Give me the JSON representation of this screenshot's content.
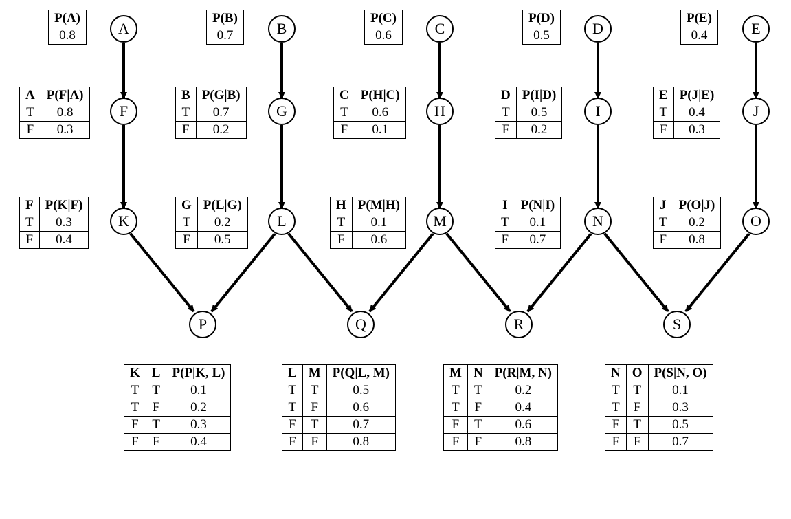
{
  "nodes": {
    "A": {
      "label": "A"
    },
    "B": {
      "label": "B"
    },
    "C": {
      "label": "C"
    },
    "D": {
      "label": "D"
    },
    "E": {
      "label": "E"
    },
    "F": {
      "label": "F"
    },
    "G": {
      "label": "G"
    },
    "H": {
      "label": "H"
    },
    "I": {
      "label": "I"
    },
    "J": {
      "label": "J"
    },
    "K": {
      "label": "K"
    },
    "L": {
      "label": "L"
    },
    "M": {
      "label": "M"
    },
    "N": {
      "label": "N"
    },
    "O": {
      "label": "O"
    },
    "P": {
      "label": "P"
    },
    "Q": {
      "label": "Q"
    },
    "R": {
      "label": "R"
    },
    "S": {
      "label": "S"
    }
  },
  "priors": {
    "A": {
      "header": "P(A)",
      "value": "0.8"
    },
    "B": {
      "header": "P(B)",
      "value": "0.7"
    },
    "C": {
      "header": "P(C)",
      "value": "0.6"
    },
    "D": {
      "header": "P(D)",
      "value": "0.5"
    },
    "E": {
      "header": "P(E)",
      "value": "0.4"
    }
  },
  "cond1": {
    "F": {
      "parent": "A",
      "header": "P(F|A)",
      "T": "0.8",
      "F": "0.3"
    },
    "G": {
      "parent": "B",
      "header": "P(G|B)",
      "T": "0.7",
      "F": "0.2"
    },
    "H": {
      "parent": "C",
      "header": "P(H|C)",
      "T": "0.6",
      "F": "0.1"
    },
    "I": {
      "parent": "D",
      "header": "P(I|D)",
      "T": "0.5",
      "F": "0.2"
    },
    "J": {
      "parent": "E",
      "header": "P(J|E)",
      "T": "0.4",
      "F": "0.3"
    },
    "K": {
      "parent": "F",
      "header": "P(K|F)",
      "T": "0.3",
      "F": "0.4"
    },
    "L": {
      "parent": "G",
      "header": "P(L|G)",
      "T": "0.2",
      "F": "0.5"
    },
    "M": {
      "parent": "H",
      "header": "P(M|H)",
      "T": "0.1",
      "F": "0.6"
    },
    "N": {
      "parent": "I",
      "header": "P(N|I)",
      "T": "0.1",
      "F": "0.7"
    },
    "O": {
      "parent": "J",
      "header": "P(O|J)",
      "T": "0.2",
      "F": "0.8"
    }
  },
  "cond2": {
    "P": {
      "p1": "K",
      "p2": "L",
      "header": "P(P|K, L)",
      "TT": "0.1",
      "TF": "0.2",
      "FT": "0.3",
      "FF": "0.4"
    },
    "Q": {
      "p1": "L",
      "p2": "M",
      "header": "P(Q|L, M)",
      "TT": "0.5",
      "TF": "0.6",
      "FT": "0.7",
      "FF": "0.8"
    },
    "R": {
      "p1": "M",
      "p2": "N",
      "header": "P(R|M, N)",
      "TT": "0.2",
      "TF": "0.4",
      "FT": "0.6",
      "FF": "0.8"
    },
    "S": {
      "p1": "N",
      "p2": "O",
      "header": "P(S|N, O)",
      "TT": "0.1",
      "TF": "0.3",
      "FT": "0.5",
      "FF": "0.7"
    }
  },
  "tf": {
    "T": "T",
    "F": "F"
  }
}
